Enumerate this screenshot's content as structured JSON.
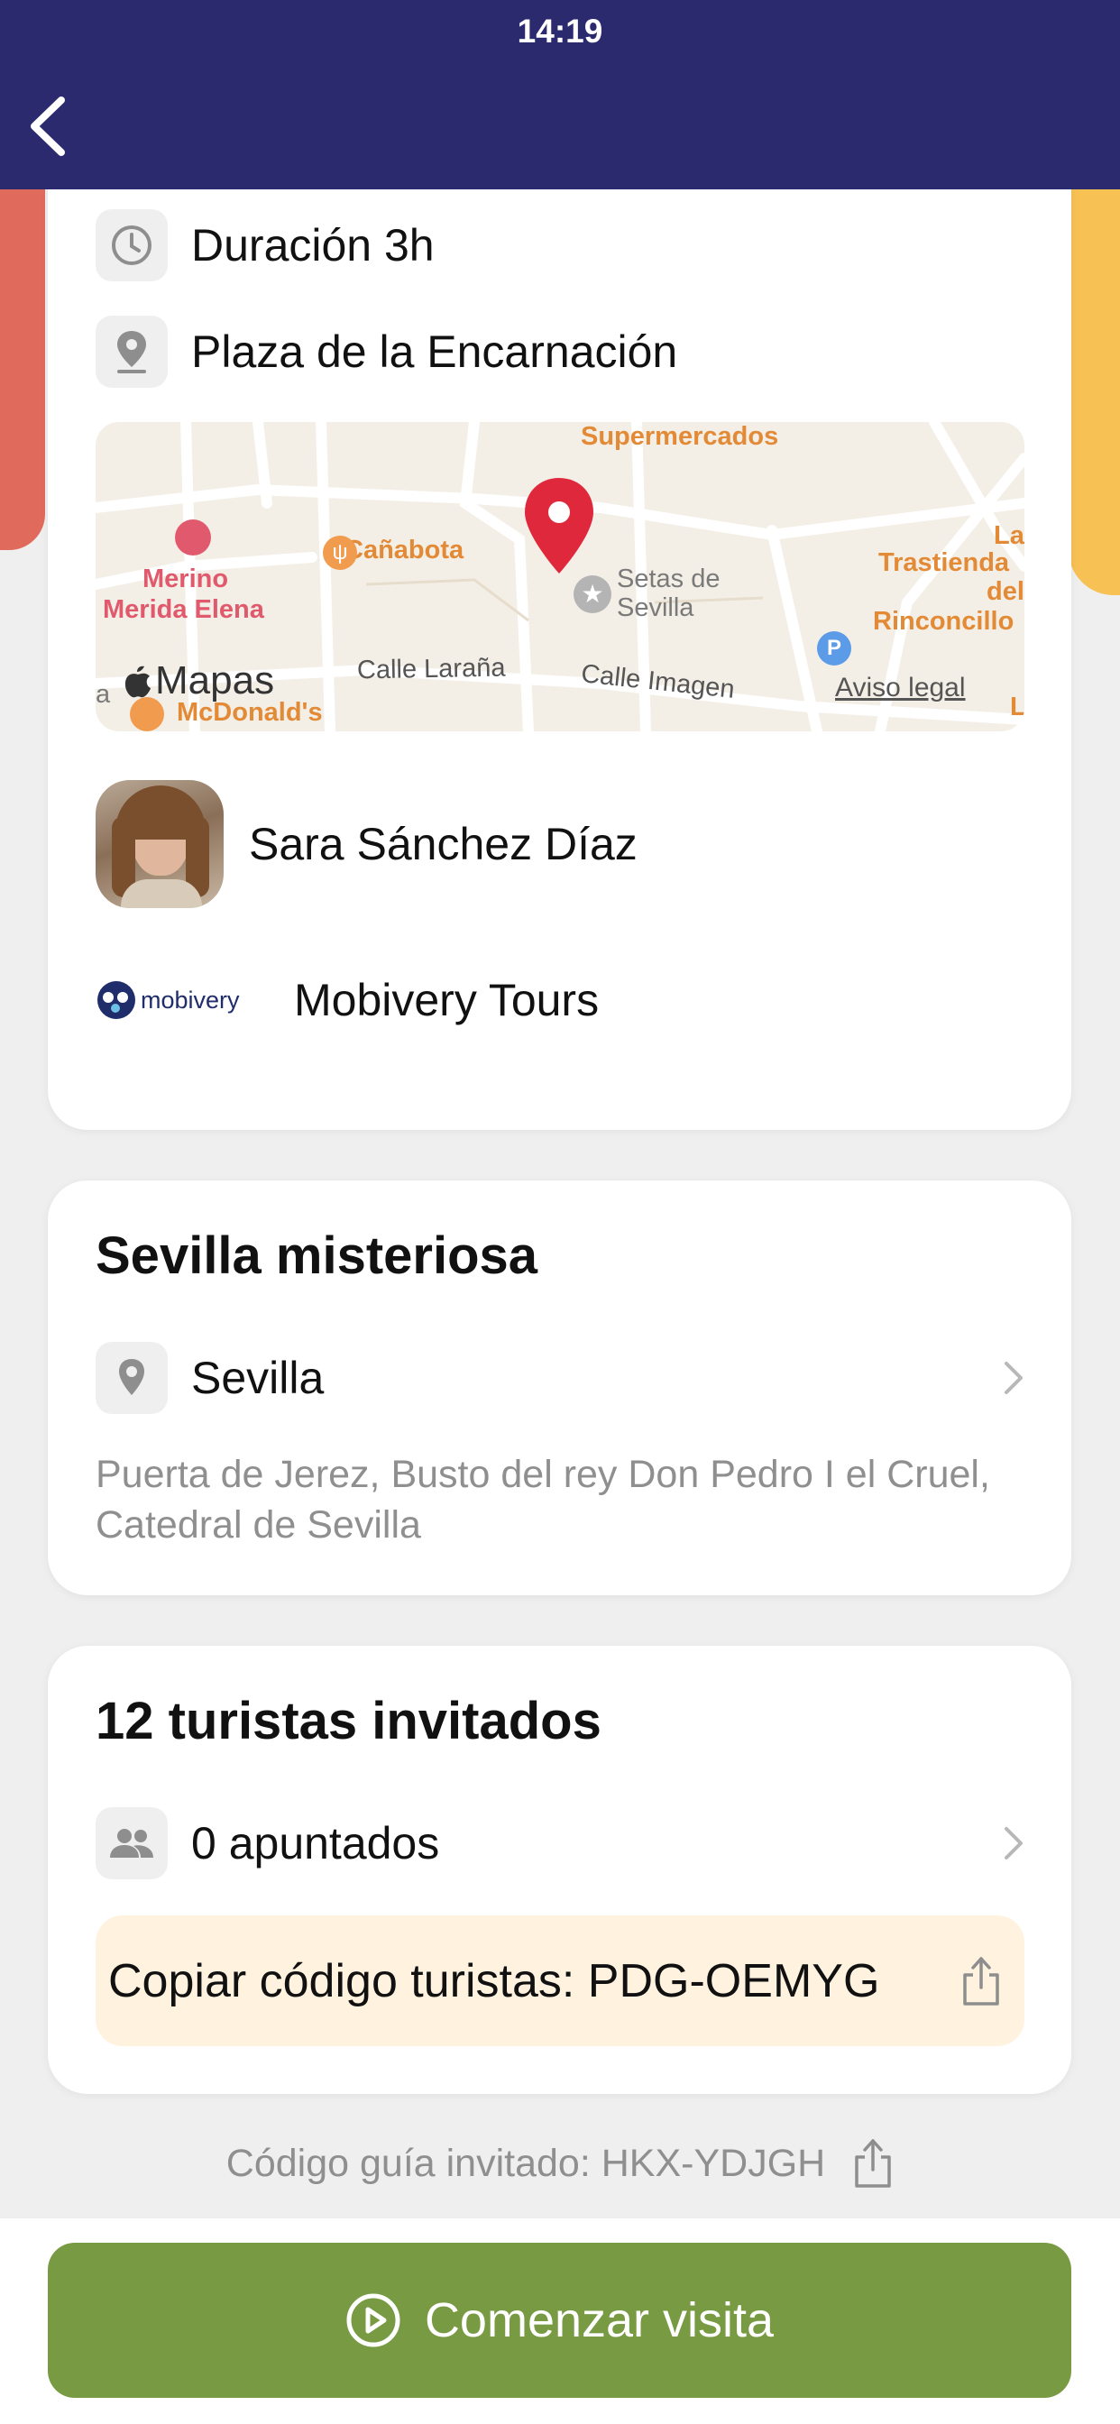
{
  "status_bar": {
    "time": "14:19"
  },
  "header": {
    "back_icon": "chevron-left-icon"
  },
  "colors": {
    "header_bg": "#2b2a6e",
    "accent_red": "#e06b5c",
    "accent_yellow": "#f7c154",
    "start_button": "#779a42",
    "code_box_bg": "#fff3df",
    "map_pin": "#e0283c"
  },
  "details": {
    "duration": "Duración 3h",
    "meeting_point": "Plaza de la Encarnación",
    "guide_name": "Sara  Sánchez Díaz",
    "company_logo_text": "mobivery",
    "company_name": "Mobivery Tours"
  },
  "map": {
    "labels": {
      "supermercados": "Supermercados",
      "canabota": "Cañabota",
      "merino1": "Merino",
      "merino2": "Merida Elena",
      "setas1": "Setas de",
      "setas2": "Sevilla",
      "trastienda1": "La",
      "trastienda2": "Trastienda",
      "trastienda3": "del",
      "trastienda4": "Rinconcillo",
      "calle_larana": "Calle Laraña",
      "calle_imagen": "Calle Imagen",
      "mcdonalds": "McDonald's",
      "mapas": "Mapas",
      "aviso": "Aviso legal",
      "a": "a",
      "l": "L"
    }
  },
  "tour": {
    "title": "Sevilla misteriosa",
    "city": "Sevilla",
    "stops": "Puerta de Jerez, Busto del rey Don Pedro I el Cruel, Catedral de Sevilla"
  },
  "tourists": {
    "title": "12 turistas invitados",
    "signed_up": "0 apuntados",
    "copy_code_label": "Copiar código turistas: PDG-OEMYG"
  },
  "guide_code": "Código guía invitado: HKX-YDJGH",
  "start_button": "Comenzar visita"
}
